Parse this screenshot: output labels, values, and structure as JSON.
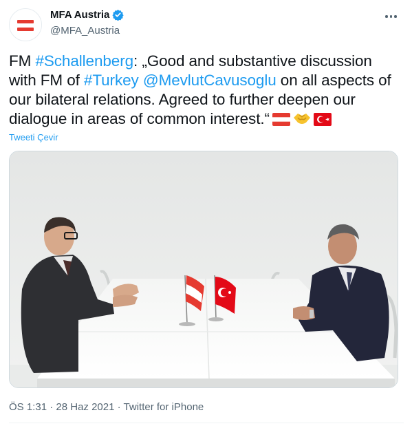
{
  "account": {
    "name": "MFA Austria",
    "handle": "@MFA_Austria",
    "verified": true,
    "avatar_colors": [
      "#e53a30",
      "#ffffff"
    ]
  },
  "tweet": {
    "prefix": "FM ",
    "hashtag1": "#Schallenberg",
    "text1": ": „Good and substantive discussion with FM of ",
    "hashtag2": "#Turkey",
    "space": " ",
    "mention": "@MevlutCavusoglu",
    "text2": " on all aspects of our bilateral relations. Agreed to further deepen our dialogue in areas of common interest.“",
    "emojis": [
      "flag-austria",
      "handshake",
      "flag-turkey"
    ]
  },
  "translate_label": "Tweeti Çevir",
  "media": {
    "icons": [
      "person-left",
      "person-right",
      "flag-austria",
      "flag-turkey",
      "table"
    ]
  },
  "meta": {
    "time": "ÖS 1:31",
    "dot1": " · ",
    "date": "28 Haz 2021",
    "dot2": " · ",
    "source": "Twitter for iPhone"
  },
  "colors": {
    "link": "#1d9bf0",
    "secondary": "#536471",
    "austria_red": "#e53a30",
    "turkey_red": "#e30a17"
  }
}
